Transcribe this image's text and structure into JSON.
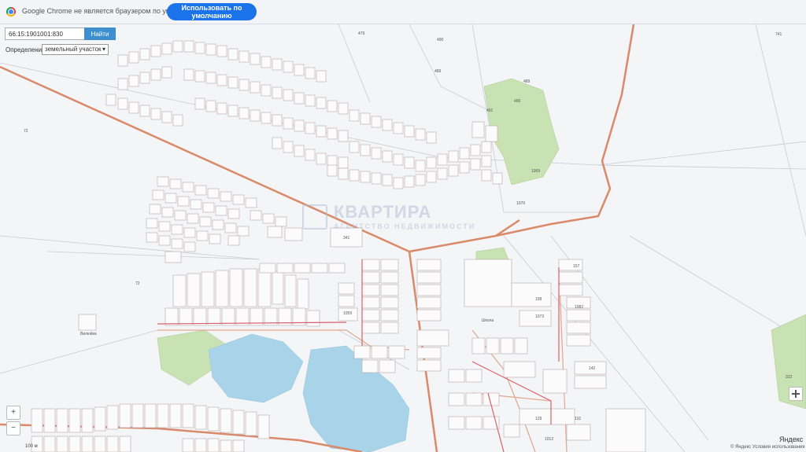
{
  "browser_banner": {
    "message": "Google Chrome не является браузером по умолчанию",
    "default_button": "Использовать по умолчанию"
  },
  "search": {
    "value": "66:15:1901001:830",
    "button": "Найти"
  },
  "definition": {
    "label": "Определение",
    "selected": "земельный участок"
  },
  "watermark": {
    "title": "КВАРТИРА",
    "subtitle": "АГЕНТСТВО НЕДВИЖИМОСТИ"
  },
  "map_labels": {
    "l1": "72",
    "l2": "72",
    "l3": "479",
    "l4": "490",
    "l5": "489",
    "l6": "489",
    "l7": "490",
    "l8": "491",
    "l9": "1069",
    "l10": "1070",
    "l11": "741",
    "l12": "341",
    "l13": "1082",
    "l14": "1059",
    "l15": "Школа",
    "l16": "Вилюйка",
    "l17": "1073",
    "l18": "158",
    "l19": "157",
    "l20": "142",
    "l21": "129",
    "l22": "131",
    "l23": "1012",
    "l24": "322"
  },
  "attribution": {
    "yandex": "Яндекс",
    "footer": "© Яндекс Условия использования",
    "scale": "100 м"
  },
  "controls": {
    "zoom_in": "+",
    "zoom_out": "−"
  },
  "colors": {
    "road": "#d98a6a",
    "water": "#a9d3e8",
    "forest": "#c9e2b3",
    "plot_line": "#b8a9ab",
    "banner_button": "#1a73e8"
  }
}
